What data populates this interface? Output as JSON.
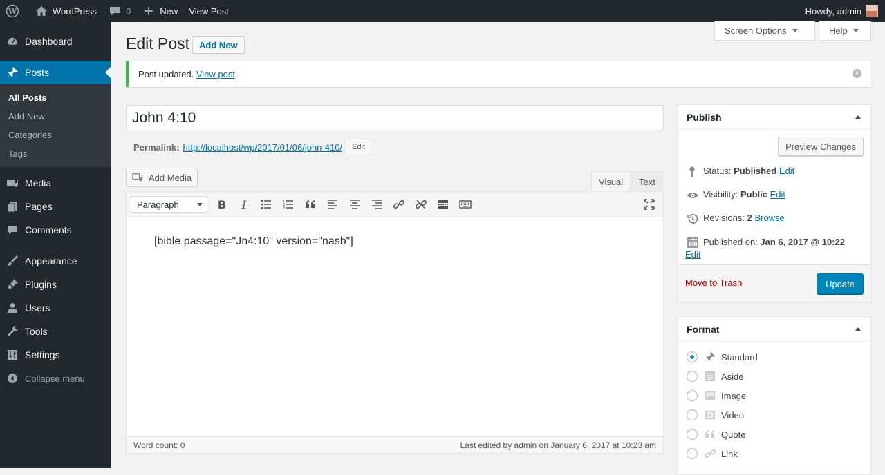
{
  "adminbar": {
    "site_name": "WordPress",
    "comments_count": "0",
    "new_label": "New",
    "view_post_label": "View Post",
    "howdy": "Howdy, admin"
  },
  "top_tabs": {
    "screen_options": "Screen Options",
    "help": "Help"
  },
  "sidebar": {
    "dashboard": "Dashboard",
    "posts": "Posts",
    "posts_sub": [
      "All Posts",
      "Add New",
      "Categories",
      "Tags"
    ],
    "media": "Media",
    "pages": "Pages",
    "comments": "Comments",
    "appearance": "Appearance",
    "plugins": "Plugins",
    "users": "Users",
    "tools": "Tools",
    "settings": "Settings",
    "collapse": "Collapse menu"
  },
  "page": {
    "title": "Edit Post",
    "add_new": "Add New"
  },
  "notice": {
    "text": "Post updated. ",
    "link": "View post"
  },
  "post": {
    "title": "John 4:10",
    "permalink_label": "Permalink:",
    "permalink_url": "http://localhost/wp/2017/01/06/john-410/",
    "permalink_edit": "Edit",
    "content": "[bible passage=\"Jn4:10\" version=\"nasb\"]",
    "word_count": "Word count: 0",
    "last_edited": "Last edited by admin on January 6, 2017 at 10:23 am"
  },
  "editor": {
    "add_media": "Add Media",
    "tab_visual": "Visual",
    "tab_text": "Text",
    "format_value": "Paragraph"
  },
  "publish": {
    "heading": "Publish",
    "preview_changes": "Preview Changes",
    "status_label": "Status: ",
    "status_value": "Published",
    "visibility_label": "Visibility: ",
    "visibility_value": "Public",
    "revisions_label": "Revisions: ",
    "revisions_value": "2",
    "browse": "Browse",
    "published_on_label": "Published on: ",
    "published_on_value": "Jan 6, 2017 @ 10:22",
    "edit": "Edit",
    "move_to_trash": "Move to Trash",
    "update": "Update"
  },
  "format": {
    "heading": "Format",
    "options": [
      "Standard",
      "Aside",
      "Image",
      "Video",
      "Quote",
      "Link"
    ],
    "selected": "Standard"
  },
  "colors": {
    "adminbar_bg": "#23282d",
    "accent": "#0073aa",
    "success": "#46b450",
    "primary_button": "#0085ba",
    "trash": "#a00"
  }
}
